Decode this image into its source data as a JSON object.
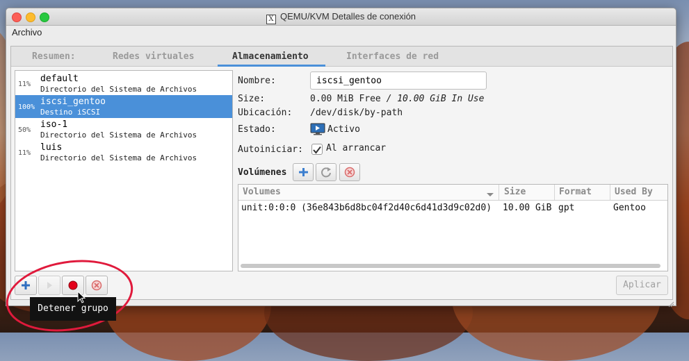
{
  "window": {
    "title": "QEMU/KVM Detalles de conexión",
    "x_glyph": "X"
  },
  "menu": {
    "items": [
      "Archivo"
    ]
  },
  "tabs": [
    {
      "label": "Resumen:",
      "active": false
    },
    {
      "label": "Redes virtuales",
      "active": false
    },
    {
      "label": "Almacenamiento",
      "active": true
    },
    {
      "label": "Interfaces de red",
      "active": false
    }
  ],
  "pools": [
    {
      "pct": "11%",
      "name": "default",
      "type": "Directorio del Sistema de Archivos",
      "selected": false
    },
    {
      "pct": "100%",
      "name": "iscsi_gentoo",
      "type": "Destino iSCSI",
      "selected": true
    },
    {
      "pct": "50%",
      "name": "iso-1",
      "type": "Directorio del Sistema de Archivos",
      "selected": false
    },
    {
      "pct": "11%",
      "name": "luis",
      "type": "Directorio del Sistema de Archivos",
      "selected": false
    }
  ],
  "details": {
    "name_label": "Nombre:",
    "name_value": "iscsi_gentoo",
    "size_label": "Size:",
    "size_free": "0.00 MiB Free",
    "size_sep": " / ",
    "size_use": "10.00 GiB In Use",
    "location_label": "Ubicación:",
    "location_value": "/dev/disk/by-path",
    "state_label": "Estado:",
    "state_value": "Activo",
    "autostart_label": "Autoiniciar:",
    "autostart_value": "Al arrancar",
    "autostart_checked": true,
    "volumes_label": "Volúmenes"
  },
  "volumes_table": {
    "columns": [
      "Volumes",
      "Size",
      "Format",
      "Used By"
    ],
    "rows": [
      {
        "volume": "unit:0:0:0 (36e843b6d8bc04f2d40c6d41d3d9c02d0)",
        "size": "10.00 GiB",
        "format": "gpt",
        "used_by": "Gentoo"
      }
    ]
  },
  "buttons": {
    "apply": "Aplicar"
  },
  "tooltip": {
    "text": "Detener grupo"
  },
  "colors": {
    "selection": "#4a90d9",
    "annotation": "#e01a3c",
    "stop_red": "#e3001b"
  },
  "icons": {
    "add": "plus-icon",
    "play": "play-icon",
    "stop": "record-stop-icon",
    "delete": "delete-icon",
    "refresh": "refresh-icon",
    "state": "monitor-icon"
  }
}
